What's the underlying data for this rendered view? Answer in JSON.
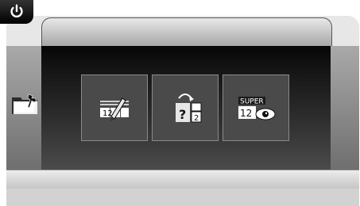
{
  "header": {
    "power_icon": "power-icon"
  },
  "sidebar": {
    "icon": "folder-settings-icon"
  },
  "menu": {
    "items": [
      {
        "icon": "numbered-edit-icon",
        "icon_text": "12"
      },
      {
        "icon": "unknown-to-numbered-icon",
        "icon_text_a": "?",
        "icon_text_b": "2"
      },
      {
        "icon": "super-numbered-view-icon",
        "icon_text_super": "SUPER",
        "icon_text_digits": "12"
      }
    ]
  },
  "colors": {
    "accent": "#ffffff",
    "panel_dark": "#121212",
    "button": "#4a4a4a"
  }
}
